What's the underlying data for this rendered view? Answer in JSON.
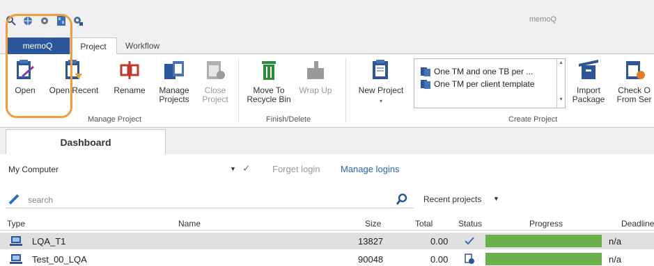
{
  "app": {
    "title": "memoQ"
  },
  "quick_access": {
    "icons": [
      "search-icon",
      "globe-icon",
      "gear-icon",
      "film-icon",
      "gear-user-icon"
    ]
  },
  "tabs": {
    "memoq": "memoQ",
    "project": "Project",
    "workflow": "Workflow"
  },
  "ribbon": {
    "open": "Open",
    "open_recent": "Open Recent",
    "rename": "Rename",
    "manage_projects": "Manage Projects",
    "close_project": "Close Project",
    "move_to_recycle_bin": "Move To Recycle Bin",
    "wrap_up": "Wrap Up",
    "new_project": "New Project",
    "import_package": "Import Package",
    "check_out": "Check O From Ser",
    "groups": {
      "manage_project": "Manage Project",
      "finish_delete": "Finish/Delete",
      "create_project": "Create Project"
    },
    "templates": [
      "One TM and one TB per ...",
      "One TM per client template"
    ]
  },
  "dashboard": {
    "tab_label": "Dashboard",
    "computer_select": "My Computer",
    "forget_login": "Forget login",
    "manage_logins": "Manage logins",
    "search_placeholder": "search",
    "recent_projects": "Recent projects"
  },
  "table": {
    "headers": {
      "type": "Type",
      "name": "Name",
      "size": "Size",
      "total": "Total",
      "status": "Status",
      "progress": "Progress",
      "deadline": "Deadline"
    },
    "rows": [
      {
        "name": "LQA_T1",
        "size": "13827",
        "total": "0.00",
        "status_icon": "check-shield-icon",
        "progress": 1.0,
        "deadline": "n/a"
      },
      {
        "name": "Test_00_LQA",
        "size": "90048",
        "total": "0.00",
        "status_icon": "document-clock-icon",
        "progress": 1.0,
        "deadline": "n/a"
      }
    ]
  },
  "colors": {
    "accent": "#2b579a",
    "link": "#1f66b5",
    "progress": "#6ab04c",
    "highlight": "#f39c3a"
  }
}
